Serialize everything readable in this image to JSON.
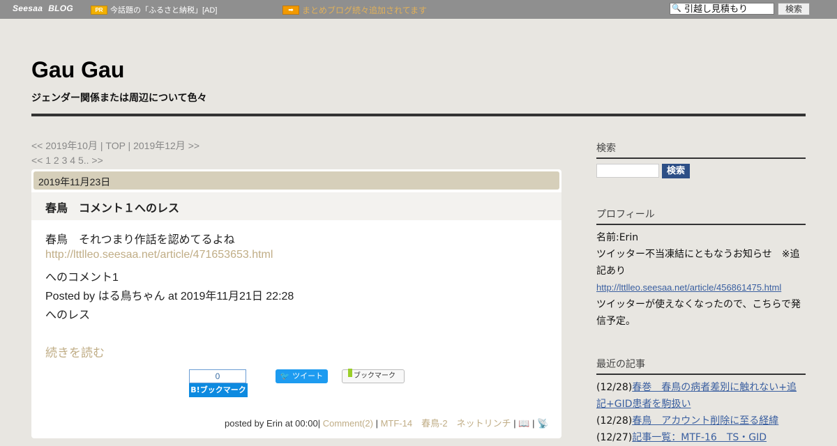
{
  "topbar": {
    "logo": "Seesaa",
    "logo_blog": "BLOG",
    "pr_badge": "PR",
    "pr_text": "今話題の「ふるさと納税」[AD]",
    "arrow_badge": "➡",
    "matome": "まとめブログ続々追加されてます",
    "search_value": "引越し見積もり",
    "search_button": "検索"
  },
  "header": {
    "title": "Gau Gau",
    "description": "ジェンダー関係または周辺について色々"
  },
  "nav": {
    "prev": "<< 2019年10月",
    "sep1": " | ",
    "top": "TOP",
    "sep2": " | ",
    "next": "2019年12月 >>",
    "pages_prev": "<<",
    "pages": "1 2 3 4 5..",
    "pages_next": ">>"
  },
  "article": {
    "date": "2019年11月23日",
    "title": "春鳥　コメント１へのレス",
    "lines": [
      "春鳥　それつまり作話を認めてるよね",
      "http://lttlleo.seesaa.net/article/471653653.html",
      "へのコメント1",
      "Posted by はる鳥ちゃん at 2019年11月21日 22:28",
      "へのレス"
    ],
    "read_more": "続きを読む",
    "hatena_count": "0",
    "hatena_label": "B!ブックマーク",
    "tweet_label": "ツイート",
    "bookmark_label": "ブックマーク",
    "posted_prefix": "posted by Erin at 00:00",
    "comment": "Comment(2)",
    "cat1": "MTF-14",
    "cat2": "春鳥-2",
    "cat3": "ネットリンチ"
  },
  "sidebar": {
    "search_head": "検索",
    "search_button": "検索",
    "profile_head": "プロフィール",
    "profile_name": "名前:Erin",
    "profile_note": "ツイッター不当凍結にともなうお知らせ　※追記あり",
    "profile_link": "http://lttlleo.seesaa.net/article/456861475.html",
    "profile_note2": "ツイッターが使えなくなったので、こちらで発信予定。",
    "recent_head": "最近の記事",
    "recent": [
      {
        "date": "(12/28)",
        "title": "春巻　春鳥の病者差別に触れない+追記+GID患者を駒扱い"
      },
      {
        "date": "(12/28)",
        "title": "春鳥　アカウント削除に至る経緯"
      },
      {
        "date": "(12/27)",
        "title": "記事一覧：MTF-16　TS・GID"
      }
    ]
  }
}
